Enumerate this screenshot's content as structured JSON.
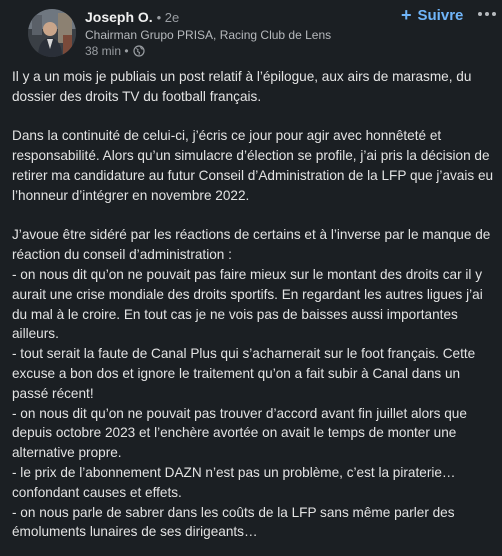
{
  "author": {
    "name": "Joseph O.",
    "degree": "• 2e",
    "headline": "Chairman Grupo PRISA, Racing Club de Lens",
    "time": "38 min •"
  },
  "actions": {
    "follow_label": "Suivre",
    "follow_icon": "plus-icon",
    "more_icon": "more-horizontal-icon"
  },
  "visibility_icon": "globe-icon",
  "colors": {
    "background": "#1b1f23",
    "accent": "#70b5f9"
  },
  "post": {
    "p1": "Il y a un mois je publiais un post relatif à l’épilogue, aux airs de marasme, du dossier des droits TV du football français.",
    "p2": "Dans la continuité de celui-ci, j’écris ce jour pour agir avec honnêteté et responsabilité. Alors qu’un simulacre d’élection se profile, j’ai pris la décision de retirer ma candidature au futur Conseil d’Administration de la LFP que j’avais eu l’honneur d’intégrer en novembre 2022.",
    "p3": "J’avoue être sidéré par les réactions de certains et à l’inverse par le manque de réaction du conseil d’administration :",
    "b1": "- on nous dit qu’on ne pouvait pas faire mieux sur le montant des droits car il y aurait une crise mondiale des droits sportifs. En regardant les autres ligues j’ai du mal à le croire. En tout cas je ne vois pas de baisses aussi importantes ailleurs.",
    "b2": "- tout serait la faute de Canal Plus qui s’acharnerait sur le foot français. Cette excuse a bon dos et ignore le traitement qu’on a fait subir à Canal dans un passé récent!",
    "b3": "- on nous dit qu’on ne pouvait pas trouver d’accord avant fin juillet alors que depuis octobre 2023 et l’enchère avortée on avait le temps de monter une alternative propre.",
    "b4": "- le prix de l’abonnement DAZN n’est pas un problème, c’est la piraterie… confondant causes et effets.",
    "b5": "- on nous parle de sabrer dans les coûts de la LFP sans même parler des émoluments lunaires de ses dirigeants…"
  }
}
